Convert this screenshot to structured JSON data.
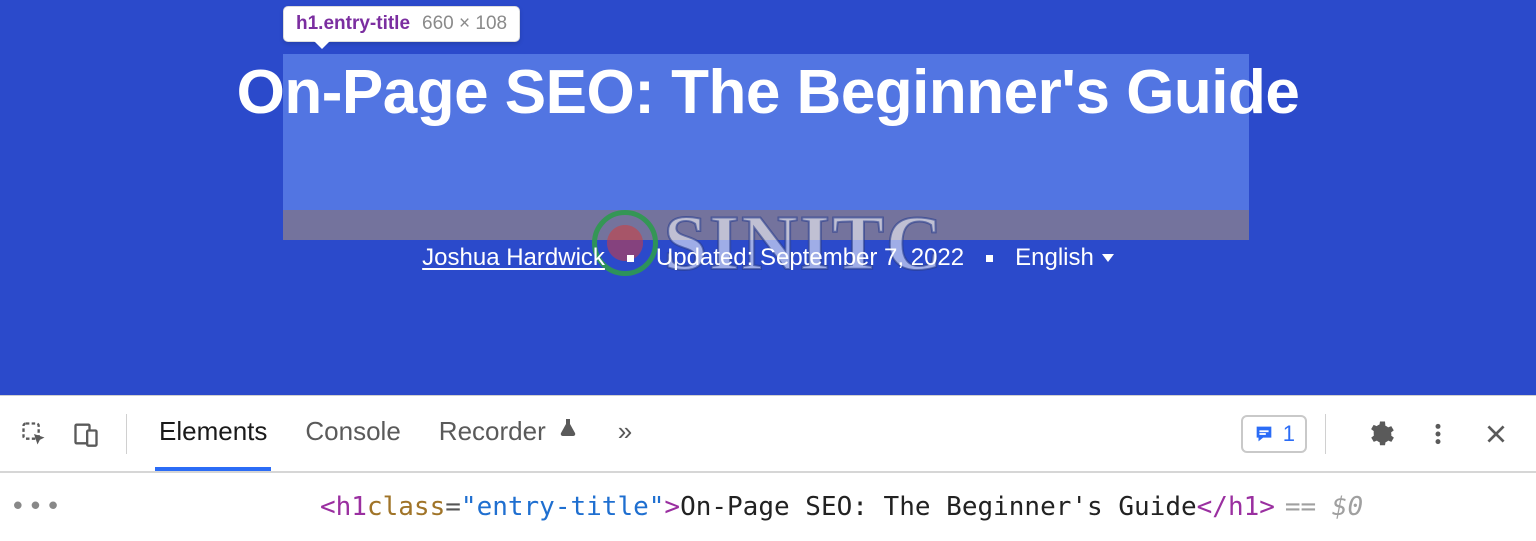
{
  "page": {
    "title": "On-Page SEO: The Beginner's Guide",
    "author": "Joshua Hardwick",
    "updated_label": "Updated: September 7, 2022",
    "language": "English"
  },
  "inspect_tooltip": {
    "selector": "h1.entry-title",
    "dimensions": "660 × 108"
  },
  "watermark": {
    "text": "SINITC"
  },
  "devtools": {
    "tabs": {
      "elements": "Elements",
      "console": "Console",
      "recorder": "Recorder"
    },
    "more_tabs_glyph": "»",
    "issues_count": "1"
  },
  "elements_panel": {
    "collapse_glyph": "•••",
    "code": {
      "open_bracket": "<",
      "tag": "h1",
      "space": " ",
      "attr_name": "class",
      "eq": "=",
      "quote": "\"",
      "attr_value": "entry-title",
      "close_bracket": ">",
      "text": "On-Page SEO: The Beginner's Guide",
      "open_close": "</",
      "selected_suffix": " == $0"
    }
  }
}
